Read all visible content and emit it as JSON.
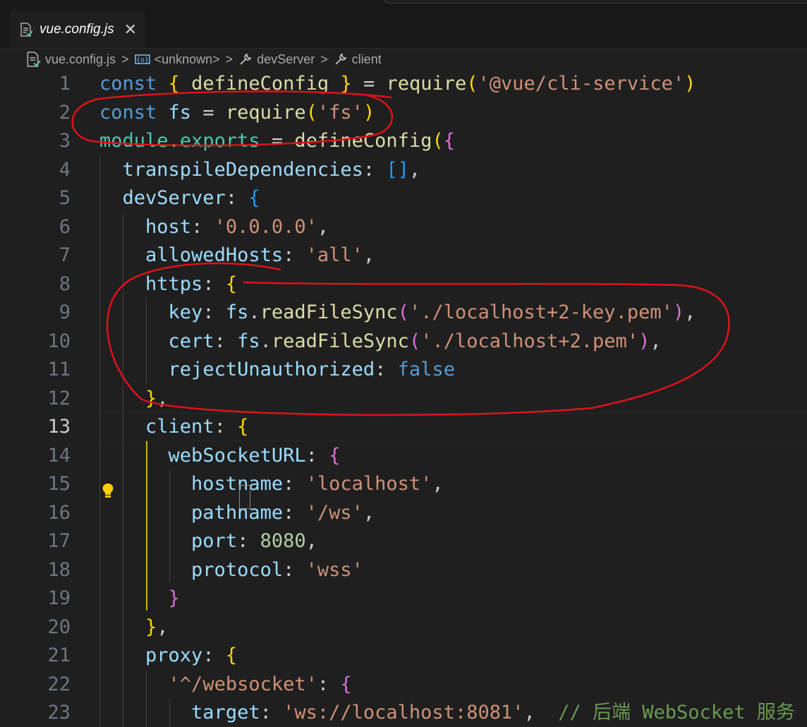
{
  "tab": {
    "title": "vue.config.js",
    "close_label": "✕"
  },
  "breadcrumb": {
    "file": "vue.config.js",
    "symbol": "<unknown>",
    "prop1": "devServer",
    "prop2": "client",
    "separator": ">"
  },
  "editor": {
    "active_line": 13,
    "lines": [
      [
        [
          "kw",
          "const"
        ],
        [
          "pun",
          " "
        ],
        [
          "b1",
          "{"
        ],
        [
          "pun",
          " "
        ],
        [
          "fn",
          "defineConfig"
        ],
        [
          "pun",
          " "
        ],
        [
          "b1",
          "}"
        ],
        [
          "pun",
          " = "
        ],
        [
          "fn",
          "require"
        ],
        [
          "b1",
          "("
        ],
        [
          "str",
          "'@vue/cli-service'"
        ],
        [
          "b1",
          ")"
        ]
      ],
      [
        [
          "kw",
          "const"
        ],
        [
          "pun",
          " "
        ],
        [
          "var",
          "fs"
        ],
        [
          "pun",
          " = "
        ],
        [
          "fn",
          "require"
        ],
        [
          "b1",
          "("
        ],
        [
          "str",
          "'fs'"
        ],
        [
          "b1",
          ")"
        ]
      ],
      [
        [
          "obj",
          "module"
        ],
        [
          "pun",
          "."
        ],
        [
          "obj",
          "exports"
        ],
        [
          "pun",
          " = "
        ],
        [
          "fn",
          "defineConfig"
        ],
        [
          "b1",
          "("
        ],
        [
          "b2",
          "{"
        ]
      ],
      [
        [
          "pun",
          "  "
        ],
        [
          "var",
          "transpileDependencies"
        ],
        [
          "pun",
          ": "
        ],
        [
          "b3",
          "[]"
        ],
        [
          "pun",
          ","
        ]
      ],
      [
        [
          "pun",
          "  "
        ],
        [
          "var",
          "devServer"
        ],
        [
          "pun",
          ": "
        ],
        [
          "b3",
          "{"
        ]
      ],
      [
        [
          "pun",
          "    "
        ],
        [
          "var",
          "host"
        ],
        [
          "pun",
          ": "
        ],
        [
          "str",
          "'0.0.0.0'"
        ],
        [
          "pun",
          ","
        ]
      ],
      [
        [
          "pun",
          "    "
        ],
        [
          "var",
          "allowedHosts"
        ],
        [
          "pun",
          ": "
        ],
        [
          "str",
          "'all'"
        ],
        [
          "pun",
          ","
        ]
      ],
      [
        [
          "pun",
          "    "
        ],
        [
          "var",
          "https"
        ],
        [
          "pun",
          ": "
        ],
        [
          "b1",
          "{"
        ]
      ],
      [
        [
          "pun",
          "      "
        ],
        [
          "var",
          "key"
        ],
        [
          "pun",
          ": "
        ],
        [
          "var",
          "fs"
        ],
        [
          "pun",
          "."
        ],
        [
          "fn",
          "readFileSync"
        ],
        [
          "b2",
          "("
        ],
        [
          "str",
          "'./localhost+2-key.pem'"
        ],
        [
          "b2",
          ")"
        ],
        [
          "pun",
          ","
        ]
      ],
      [
        [
          "pun",
          "      "
        ],
        [
          "var",
          "cert"
        ],
        [
          "pun",
          ": "
        ],
        [
          "var",
          "fs"
        ],
        [
          "pun",
          "."
        ],
        [
          "fn",
          "readFileSync"
        ],
        [
          "b2",
          "("
        ],
        [
          "str",
          "'./localhost+2.pem'"
        ],
        [
          "b2",
          ")"
        ],
        [
          "pun",
          ","
        ]
      ],
      [
        [
          "pun",
          "      "
        ],
        [
          "var",
          "rejectUnauthorized"
        ],
        [
          "pun",
          ": "
        ],
        [
          "kw",
          "false"
        ]
      ],
      [
        [
          "pun",
          "    "
        ],
        [
          "b1",
          "}"
        ],
        [
          "pun",
          ","
        ]
      ],
      [
        [
          "pun",
          "    "
        ],
        [
          "var",
          "client"
        ],
        [
          "pun",
          ": "
        ],
        [
          "b1",
          "{"
        ]
      ],
      [
        [
          "pun",
          "      "
        ],
        [
          "var",
          "webSocketURL"
        ],
        [
          "pun",
          ": "
        ],
        [
          "b2",
          "{"
        ]
      ],
      [
        [
          "pun",
          "        "
        ],
        [
          "var",
          "hostname"
        ],
        [
          "pun",
          ": "
        ],
        [
          "str",
          "'localhost'"
        ],
        [
          "pun",
          ","
        ]
      ],
      [
        [
          "pun",
          "        "
        ],
        [
          "var",
          "pathname"
        ],
        [
          "pun",
          ": "
        ],
        [
          "str",
          "'/ws'"
        ],
        [
          "pun",
          ","
        ]
      ],
      [
        [
          "pun",
          "        "
        ],
        [
          "var",
          "port"
        ],
        [
          "pun",
          ": "
        ],
        [
          "num",
          "8080"
        ],
        [
          "pun",
          ","
        ]
      ],
      [
        [
          "pun",
          "        "
        ],
        [
          "var",
          "protocol"
        ],
        [
          "pun",
          ": "
        ],
        [
          "str",
          "'wss'"
        ]
      ],
      [
        [
          "pun",
          "      "
        ],
        [
          "b2",
          "}"
        ]
      ],
      [
        [
          "pun",
          "    "
        ],
        [
          "b1",
          "}"
        ],
        [
          "pun",
          ","
        ]
      ],
      [
        [
          "pun",
          "    "
        ],
        [
          "var",
          "proxy"
        ],
        [
          "pun",
          ": "
        ],
        [
          "b1",
          "{"
        ]
      ],
      [
        [
          "pun",
          "      "
        ],
        [
          "str",
          "'^/websocket'"
        ],
        [
          "pun",
          ": "
        ],
        [
          "b2",
          "{"
        ]
      ],
      [
        [
          "pun",
          "        "
        ],
        [
          "var",
          "target"
        ],
        [
          "pun",
          ": "
        ],
        [
          "str",
          "'ws://localhost:8081'"
        ],
        [
          "pun",
          ",  "
        ],
        [
          "cm",
          "// 后端 WebSocket 服务"
        ]
      ]
    ]
  },
  "colors": {
    "background": "#1f1f1f",
    "keyword": "#569cd6",
    "variable": "#9cdcfe",
    "function": "#dcdcaa",
    "string": "#ce9178",
    "number": "#b5cea8",
    "comment": "#6a9955",
    "annotation": "#e0111b"
  }
}
